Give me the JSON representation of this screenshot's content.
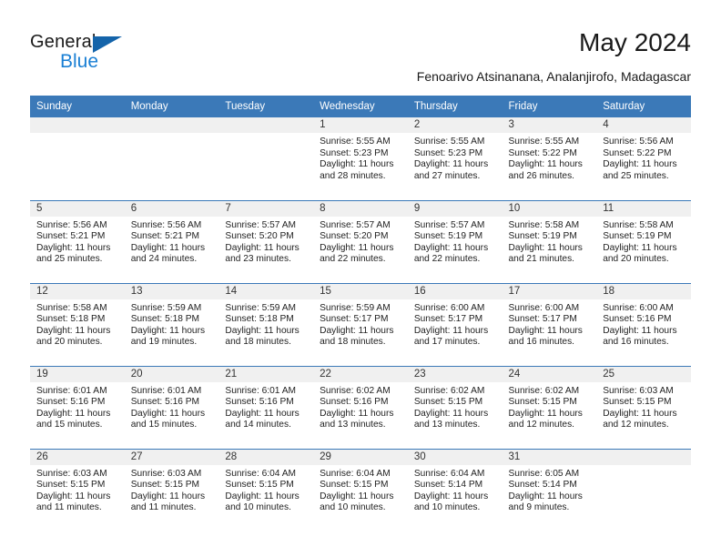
{
  "brand": {
    "name_top": "General",
    "name_bottom": "Blue",
    "accent_color": "#1a7fd4",
    "triangle_color": "#1464aa"
  },
  "header": {
    "title": "May 2024",
    "subtitle": "Fenoarivo Atsinanana, Analanjirofo, Madagascar"
  },
  "calendar": {
    "header_bg": "#3b79b8",
    "daynum_bg": "#f0f0f0",
    "weekdays": [
      "Sunday",
      "Monday",
      "Tuesday",
      "Wednesday",
      "Thursday",
      "Friday",
      "Saturday"
    ],
    "weeks": [
      [
        {
          "day": "",
          "sunrise": "",
          "sunset": "",
          "daylight": ""
        },
        {
          "day": "",
          "sunrise": "",
          "sunset": "",
          "daylight": ""
        },
        {
          "day": "",
          "sunrise": "",
          "sunset": "",
          "daylight": ""
        },
        {
          "day": "1",
          "sunrise": "Sunrise: 5:55 AM",
          "sunset": "Sunset: 5:23 PM",
          "daylight": "Daylight: 11 hours and 28 minutes."
        },
        {
          "day": "2",
          "sunrise": "Sunrise: 5:55 AM",
          "sunset": "Sunset: 5:23 PM",
          "daylight": "Daylight: 11 hours and 27 minutes."
        },
        {
          "day": "3",
          "sunrise": "Sunrise: 5:55 AM",
          "sunset": "Sunset: 5:22 PM",
          "daylight": "Daylight: 11 hours and 26 minutes."
        },
        {
          "day": "4",
          "sunrise": "Sunrise: 5:56 AM",
          "sunset": "Sunset: 5:22 PM",
          "daylight": "Daylight: 11 hours and 25 minutes."
        }
      ],
      [
        {
          "day": "5",
          "sunrise": "Sunrise: 5:56 AM",
          "sunset": "Sunset: 5:21 PM",
          "daylight": "Daylight: 11 hours and 25 minutes."
        },
        {
          "day": "6",
          "sunrise": "Sunrise: 5:56 AM",
          "sunset": "Sunset: 5:21 PM",
          "daylight": "Daylight: 11 hours and 24 minutes."
        },
        {
          "day": "7",
          "sunrise": "Sunrise: 5:57 AM",
          "sunset": "Sunset: 5:20 PM",
          "daylight": "Daylight: 11 hours and 23 minutes."
        },
        {
          "day": "8",
          "sunrise": "Sunrise: 5:57 AM",
          "sunset": "Sunset: 5:20 PM",
          "daylight": "Daylight: 11 hours and 22 minutes."
        },
        {
          "day": "9",
          "sunrise": "Sunrise: 5:57 AM",
          "sunset": "Sunset: 5:19 PM",
          "daylight": "Daylight: 11 hours and 22 minutes."
        },
        {
          "day": "10",
          "sunrise": "Sunrise: 5:58 AM",
          "sunset": "Sunset: 5:19 PM",
          "daylight": "Daylight: 11 hours and 21 minutes."
        },
        {
          "day": "11",
          "sunrise": "Sunrise: 5:58 AM",
          "sunset": "Sunset: 5:19 PM",
          "daylight": "Daylight: 11 hours and 20 minutes."
        }
      ],
      [
        {
          "day": "12",
          "sunrise": "Sunrise: 5:58 AM",
          "sunset": "Sunset: 5:18 PM",
          "daylight": "Daylight: 11 hours and 20 minutes."
        },
        {
          "day": "13",
          "sunrise": "Sunrise: 5:59 AM",
          "sunset": "Sunset: 5:18 PM",
          "daylight": "Daylight: 11 hours and 19 minutes."
        },
        {
          "day": "14",
          "sunrise": "Sunrise: 5:59 AM",
          "sunset": "Sunset: 5:18 PM",
          "daylight": "Daylight: 11 hours and 18 minutes."
        },
        {
          "day": "15",
          "sunrise": "Sunrise: 5:59 AM",
          "sunset": "Sunset: 5:17 PM",
          "daylight": "Daylight: 11 hours and 18 minutes."
        },
        {
          "day": "16",
          "sunrise": "Sunrise: 6:00 AM",
          "sunset": "Sunset: 5:17 PM",
          "daylight": "Daylight: 11 hours and 17 minutes."
        },
        {
          "day": "17",
          "sunrise": "Sunrise: 6:00 AM",
          "sunset": "Sunset: 5:17 PM",
          "daylight": "Daylight: 11 hours and 16 minutes."
        },
        {
          "day": "18",
          "sunrise": "Sunrise: 6:00 AM",
          "sunset": "Sunset: 5:16 PM",
          "daylight": "Daylight: 11 hours and 16 minutes."
        }
      ],
      [
        {
          "day": "19",
          "sunrise": "Sunrise: 6:01 AM",
          "sunset": "Sunset: 5:16 PM",
          "daylight": "Daylight: 11 hours and 15 minutes."
        },
        {
          "day": "20",
          "sunrise": "Sunrise: 6:01 AM",
          "sunset": "Sunset: 5:16 PM",
          "daylight": "Daylight: 11 hours and 15 minutes."
        },
        {
          "day": "21",
          "sunrise": "Sunrise: 6:01 AM",
          "sunset": "Sunset: 5:16 PM",
          "daylight": "Daylight: 11 hours and 14 minutes."
        },
        {
          "day": "22",
          "sunrise": "Sunrise: 6:02 AM",
          "sunset": "Sunset: 5:16 PM",
          "daylight": "Daylight: 11 hours and 13 minutes."
        },
        {
          "day": "23",
          "sunrise": "Sunrise: 6:02 AM",
          "sunset": "Sunset: 5:15 PM",
          "daylight": "Daylight: 11 hours and 13 minutes."
        },
        {
          "day": "24",
          "sunrise": "Sunrise: 6:02 AM",
          "sunset": "Sunset: 5:15 PM",
          "daylight": "Daylight: 11 hours and 12 minutes."
        },
        {
          "day": "25",
          "sunrise": "Sunrise: 6:03 AM",
          "sunset": "Sunset: 5:15 PM",
          "daylight": "Daylight: 11 hours and 12 minutes."
        }
      ],
      [
        {
          "day": "26",
          "sunrise": "Sunrise: 6:03 AM",
          "sunset": "Sunset: 5:15 PM",
          "daylight": "Daylight: 11 hours and 11 minutes."
        },
        {
          "day": "27",
          "sunrise": "Sunrise: 6:03 AM",
          "sunset": "Sunset: 5:15 PM",
          "daylight": "Daylight: 11 hours and 11 minutes."
        },
        {
          "day": "28",
          "sunrise": "Sunrise: 6:04 AM",
          "sunset": "Sunset: 5:15 PM",
          "daylight": "Daylight: 11 hours and 10 minutes."
        },
        {
          "day": "29",
          "sunrise": "Sunrise: 6:04 AM",
          "sunset": "Sunset: 5:15 PM",
          "daylight": "Daylight: 11 hours and 10 minutes."
        },
        {
          "day": "30",
          "sunrise": "Sunrise: 6:04 AM",
          "sunset": "Sunset: 5:14 PM",
          "daylight": "Daylight: 11 hours and 10 minutes."
        },
        {
          "day": "31",
          "sunrise": "Sunrise: 6:05 AM",
          "sunset": "Sunset: 5:14 PM",
          "daylight": "Daylight: 11 hours and 9 minutes."
        },
        {
          "day": "",
          "sunrise": "",
          "sunset": "",
          "daylight": ""
        }
      ]
    ]
  }
}
